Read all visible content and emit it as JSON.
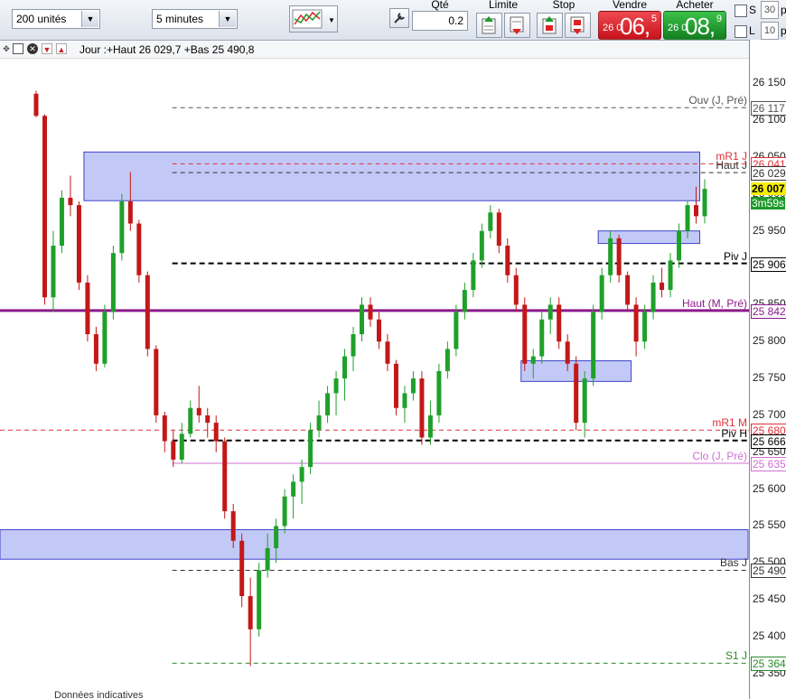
{
  "toolbar": {
    "quantity_units": "200 unités",
    "timeframe": "5 minutes",
    "qty_label": "Qté",
    "qty_value": "0.2",
    "limit_label": "Limite",
    "stop_label": "Stop",
    "sell_label": "Vendre",
    "buy_label": "Acheter",
    "sell_prefix": "26 0",
    "sell_big": "06,",
    "sell_sup": "5",
    "buy_prefix": "26 0",
    "buy_big": "08,",
    "buy_sup": "9",
    "side_s": "S",
    "side_s_value": "30",
    "side_l": "L",
    "side_l_value": "10",
    "side_p1": "p",
    "side_p2": "p"
  },
  "chart_header": {
    "info": "Jour :+Haut 26 029,7 +Bas 25 490,8",
    "footer": "Données indicatives"
  },
  "colors": {
    "up": "#1fa02a",
    "down": "#c31818",
    "zone_fill": "#b8bff5",
    "zone_stroke": "#3c44c8",
    "monthly_high": "#8b1a8b",
    "sell_bg": "#d9222a",
    "buy_bg": "#1f9b2a"
  },
  "chart_data": {
    "type": "candlestick",
    "ylim": [
      25340,
      26170
    ],
    "y_ticks": [
      "26 150",
      "26 100",
      "26 050",
      "26 000",
      "25 950",
      "25 900",
      "25 850",
      "25 800",
      "25 750",
      "25 700",
      "25 650",
      "25 600",
      "25 550",
      "25 500",
      "25 450",
      "25 400",
      "25 350"
    ],
    "y_tick_values": [
      26150,
      26100,
      26050,
      26000,
      25950,
      25900,
      25850,
      25800,
      25750,
      25700,
      25650,
      25600,
      25550,
      25500,
      25450,
      25400,
      25350
    ],
    "last_price": "26 007",
    "countdown": "3m59s",
    "levels": [
      {
        "name": "Ouv (J, Pré)",
        "value": 26117,
        "label": "26 117",
        "color": "#555555",
        "style": "dashed",
        "from_x": 0.23
      },
      {
        "name": "mR1 J",
        "value": 26041,
        "label": "26 041",
        "color": "#e0303a",
        "style": "dashed",
        "from_x": 0.23
      },
      {
        "name": "Haut J",
        "value": 26029,
        "label": "26 029",
        "color": "#333333",
        "style": "dashed",
        "from_x": 0.23
      },
      {
        "name": "Piv J",
        "value": 25906,
        "label": "25 906",
        "color": "#000000",
        "style": "dashed-bold",
        "from_x": 0.23
      },
      {
        "name": "Haut (M, Pré)",
        "value": 25842,
        "label": "25 842",
        "color": "#8b1a8b",
        "style": "solid-bold",
        "from_x": 0
      },
      {
        "name": "mR1 M",
        "value": 25680,
        "label": "25 680",
        "color": "#e0303a",
        "style": "dashed",
        "from_x": 0
      },
      {
        "name": "Piv H",
        "value": 25666,
        "label": "25 666",
        "color": "#000000",
        "style": "dashed-bold",
        "from_x": 0.23
      },
      {
        "name": "Clo (J, Pré)",
        "value": 25635,
        "label": "25 635",
        "color": "#d070d0",
        "style": "solid",
        "from_x": 0.23
      },
      {
        "name": "Bas J",
        "value": 25490,
        "label": "25 490",
        "color": "#333333",
        "style": "dashed",
        "from_x": 0.23
      },
      {
        "name": "S1 J",
        "value": 25364,
        "label": "25 364",
        "color": "#2a8a2a",
        "style": "dashed",
        "from_x": 0.23
      }
    ],
    "zones": [
      {
        "t0": 6,
        "t1": 77,
        "high": 26057,
        "low": 25991
      },
      {
        "t0": 66,
        "t1": 77,
        "high": 25950,
        "low": 25933
      },
      {
        "t0": 57,
        "t1": 69,
        "high": 25774,
        "low": 25746
      },
      {
        "t0": -1,
        "t1": 81,
        "high": 25545,
        "low": 25505
      }
    ],
    "candles": [
      [
        26136,
        26140,
        26104,
        26106
      ],
      [
        26106,
        26108,
        25850,
        25860
      ],
      [
        25860,
        25950,
        25840,
        25930
      ],
      [
        25930,
        26005,
        25920,
        25995
      ],
      [
        25995,
        26025,
        25970,
        25985
      ],
      [
        25985,
        25990,
        25870,
        25880
      ],
      [
        25880,
        25890,
        25800,
        25810
      ],
      [
        25810,
        25820,
        25760,
        25770
      ],
      [
        25770,
        25850,
        25765,
        25840
      ],
      [
        25840,
        25930,
        25830,
        25920
      ],
      [
        25920,
        26000,
        25910,
        25990
      ],
      [
        25990,
        26030,
        25950,
        25960
      ],
      [
        25960,
        25965,
        25880,
        25890
      ],
      [
        25890,
        25895,
        25780,
        25790
      ],
      [
        25790,
        25795,
        25690,
        25700
      ],
      [
        25700,
        25705,
        25650,
        25665
      ],
      [
        25665,
        25680,
        25630,
        25640
      ],
      [
        25640,
        25690,
        25635,
        25675
      ],
      [
        25675,
        25720,
        25670,
        25710
      ],
      [
        25710,
        25740,
        25690,
        25700
      ],
      [
        25700,
        25710,
        25670,
        25690
      ],
      [
        25690,
        25700,
        25650,
        25665
      ],
      [
        25665,
        25670,
        25560,
        25570
      ],
      [
        25570,
        25580,
        25520,
        25530
      ],
      [
        25530,
        25540,
        25440,
        25455
      ],
      [
        25455,
        25480,
        25360,
        25410
      ],
      [
        25410,
        25500,
        25400,
        25490
      ],
      [
        25490,
        25540,
        25480,
        25520
      ],
      [
        25520,
        25560,
        25500,
        25550
      ],
      [
        25550,
        25600,
        25540,
        25590
      ],
      [
        25590,
        25620,
        25560,
        25610
      ],
      [
        25610,
        25640,
        25580,
        25630
      ],
      [
        25630,
        25690,
        25620,
        25680
      ],
      [
        25680,
        25720,
        25670,
        25700
      ],
      [
        25700,
        25740,
        25690,
        25730
      ],
      [
        25730,
        25760,
        25700,
        25750
      ],
      [
        25750,
        25790,
        25720,
        25780
      ],
      [
        25780,
        25820,
        25760,
        25810
      ],
      [
        25810,
        25860,
        25800,
        25850
      ],
      [
        25850,
        25860,
        25820,
        25830
      ],
      [
        25830,
        25840,
        25790,
        25800
      ],
      [
        25800,
        25810,
        25760,
        25770
      ],
      [
        25770,
        25775,
        25700,
        25710
      ],
      [
        25710,
        25740,
        25690,
        25730
      ],
      [
        25730,
        25760,
        25720,
        25750
      ],
      [
        25750,
        25760,
        25660,
        25670
      ],
      [
        25670,
        25720,
        25660,
        25700
      ],
      [
        25700,
        25770,
        25690,
        25760
      ],
      [
        25760,
        25800,
        25750,
        25790
      ],
      [
        25790,
        25850,
        25780,
        25840
      ],
      [
        25840,
        25880,
        25830,
        25870
      ],
      [
        25870,
        25920,
        25860,
        25910
      ],
      [
        25910,
        25960,
        25900,
        25950
      ],
      [
        25950,
        25985,
        25940,
        25975
      ],
      [
        25975,
        25980,
        25920,
        25930
      ],
      [
        25930,
        25940,
        25880,
        25890
      ],
      [
        25890,
        25900,
        25840,
        25850
      ],
      [
        25850,
        25860,
        25760,
        25770
      ],
      [
        25770,
        25790,
        25750,
        25780
      ],
      [
        25780,
        25840,
        25770,
        25830
      ],
      [
        25830,
        25860,
        25810,
        25850
      ],
      [
        25850,
        25860,
        25790,
        25800
      ],
      [
        25800,
        25810,
        25760,
        25770
      ],
      [
        25770,
        25780,
        25680,
        25690
      ],
      [
        25690,
        25760,
        25670,
        25750
      ],
      [
        25750,
        25850,
        25740,
        25840
      ],
      [
        25840,
        25900,
        25830,
        25890
      ],
      [
        25890,
        25950,
        25880,
        25940
      ],
      [
        25940,
        25945,
        25880,
        25890
      ],
      [
        25890,
        25895,
        25840,
        25850
      ],
      [
        25850,
        25860,
        25780,
        25800
      ],
      [
        25800,
        25850,
        25790,
        25840
      ],
      [
        25840,
        25890,
        25830,
        25880
      ],
      [
        25880,
        25900,
        25860,
        25870
      ],
      [
        25870,
        25920,
        25860,
        25910
      ],
      [
        25910,
        25960,
        25900,
        25950
      ],
      [
        25950,
        25990,
        25940,
        25985
      ],
      [
        25985,
        26010,
        25960,
        25970
      ],
      [
        25970,
        26020,
        25960,
        26007
      ]
    ]
  }
}
